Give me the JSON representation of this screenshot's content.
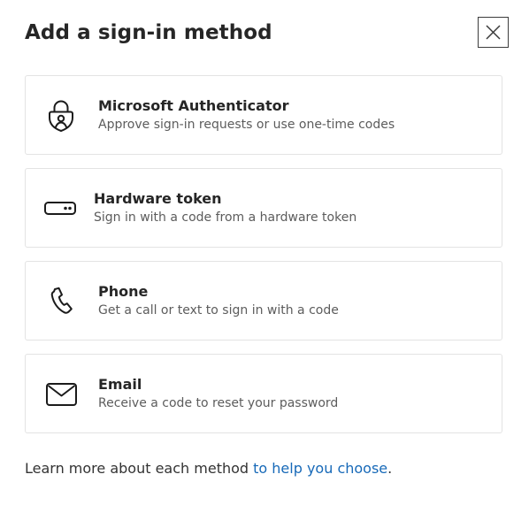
{
  "dialog": {
    "title": "Add a sign-in method",
    "close_icon": "close-icon"
  },
  "methods": [
    {
      "name": "Microsoft Authenticator",
      "description": "Approve sign-in requests or use one-time codes",
      "icon": "authenticator-lock-icon"
    },
    {
      "name": "Hardware token",
      "description": "Sign in with a code from a hardware token",
      "icon": "hardware-token-icon"
    },
    {
      "name": "Phone",
      "description": "Get a call or text to sign in with a code",
      "icon": "phone-icon"
    },
    {
      "name": "Email",
      "description": "Receive a code to reset your password",
      "icon": "envelope-icon"
    }
  ],
  "footer": {
    "text": "Learn more about each method ",
    "link_text": "to help you choose",
    "suffix": "."
  },
  "colors": {
    "link": "#1769b8",
    "border": "#e3e3e3",
    "title": "#262626",
    "description": "#5c5c5c"
  }
}
